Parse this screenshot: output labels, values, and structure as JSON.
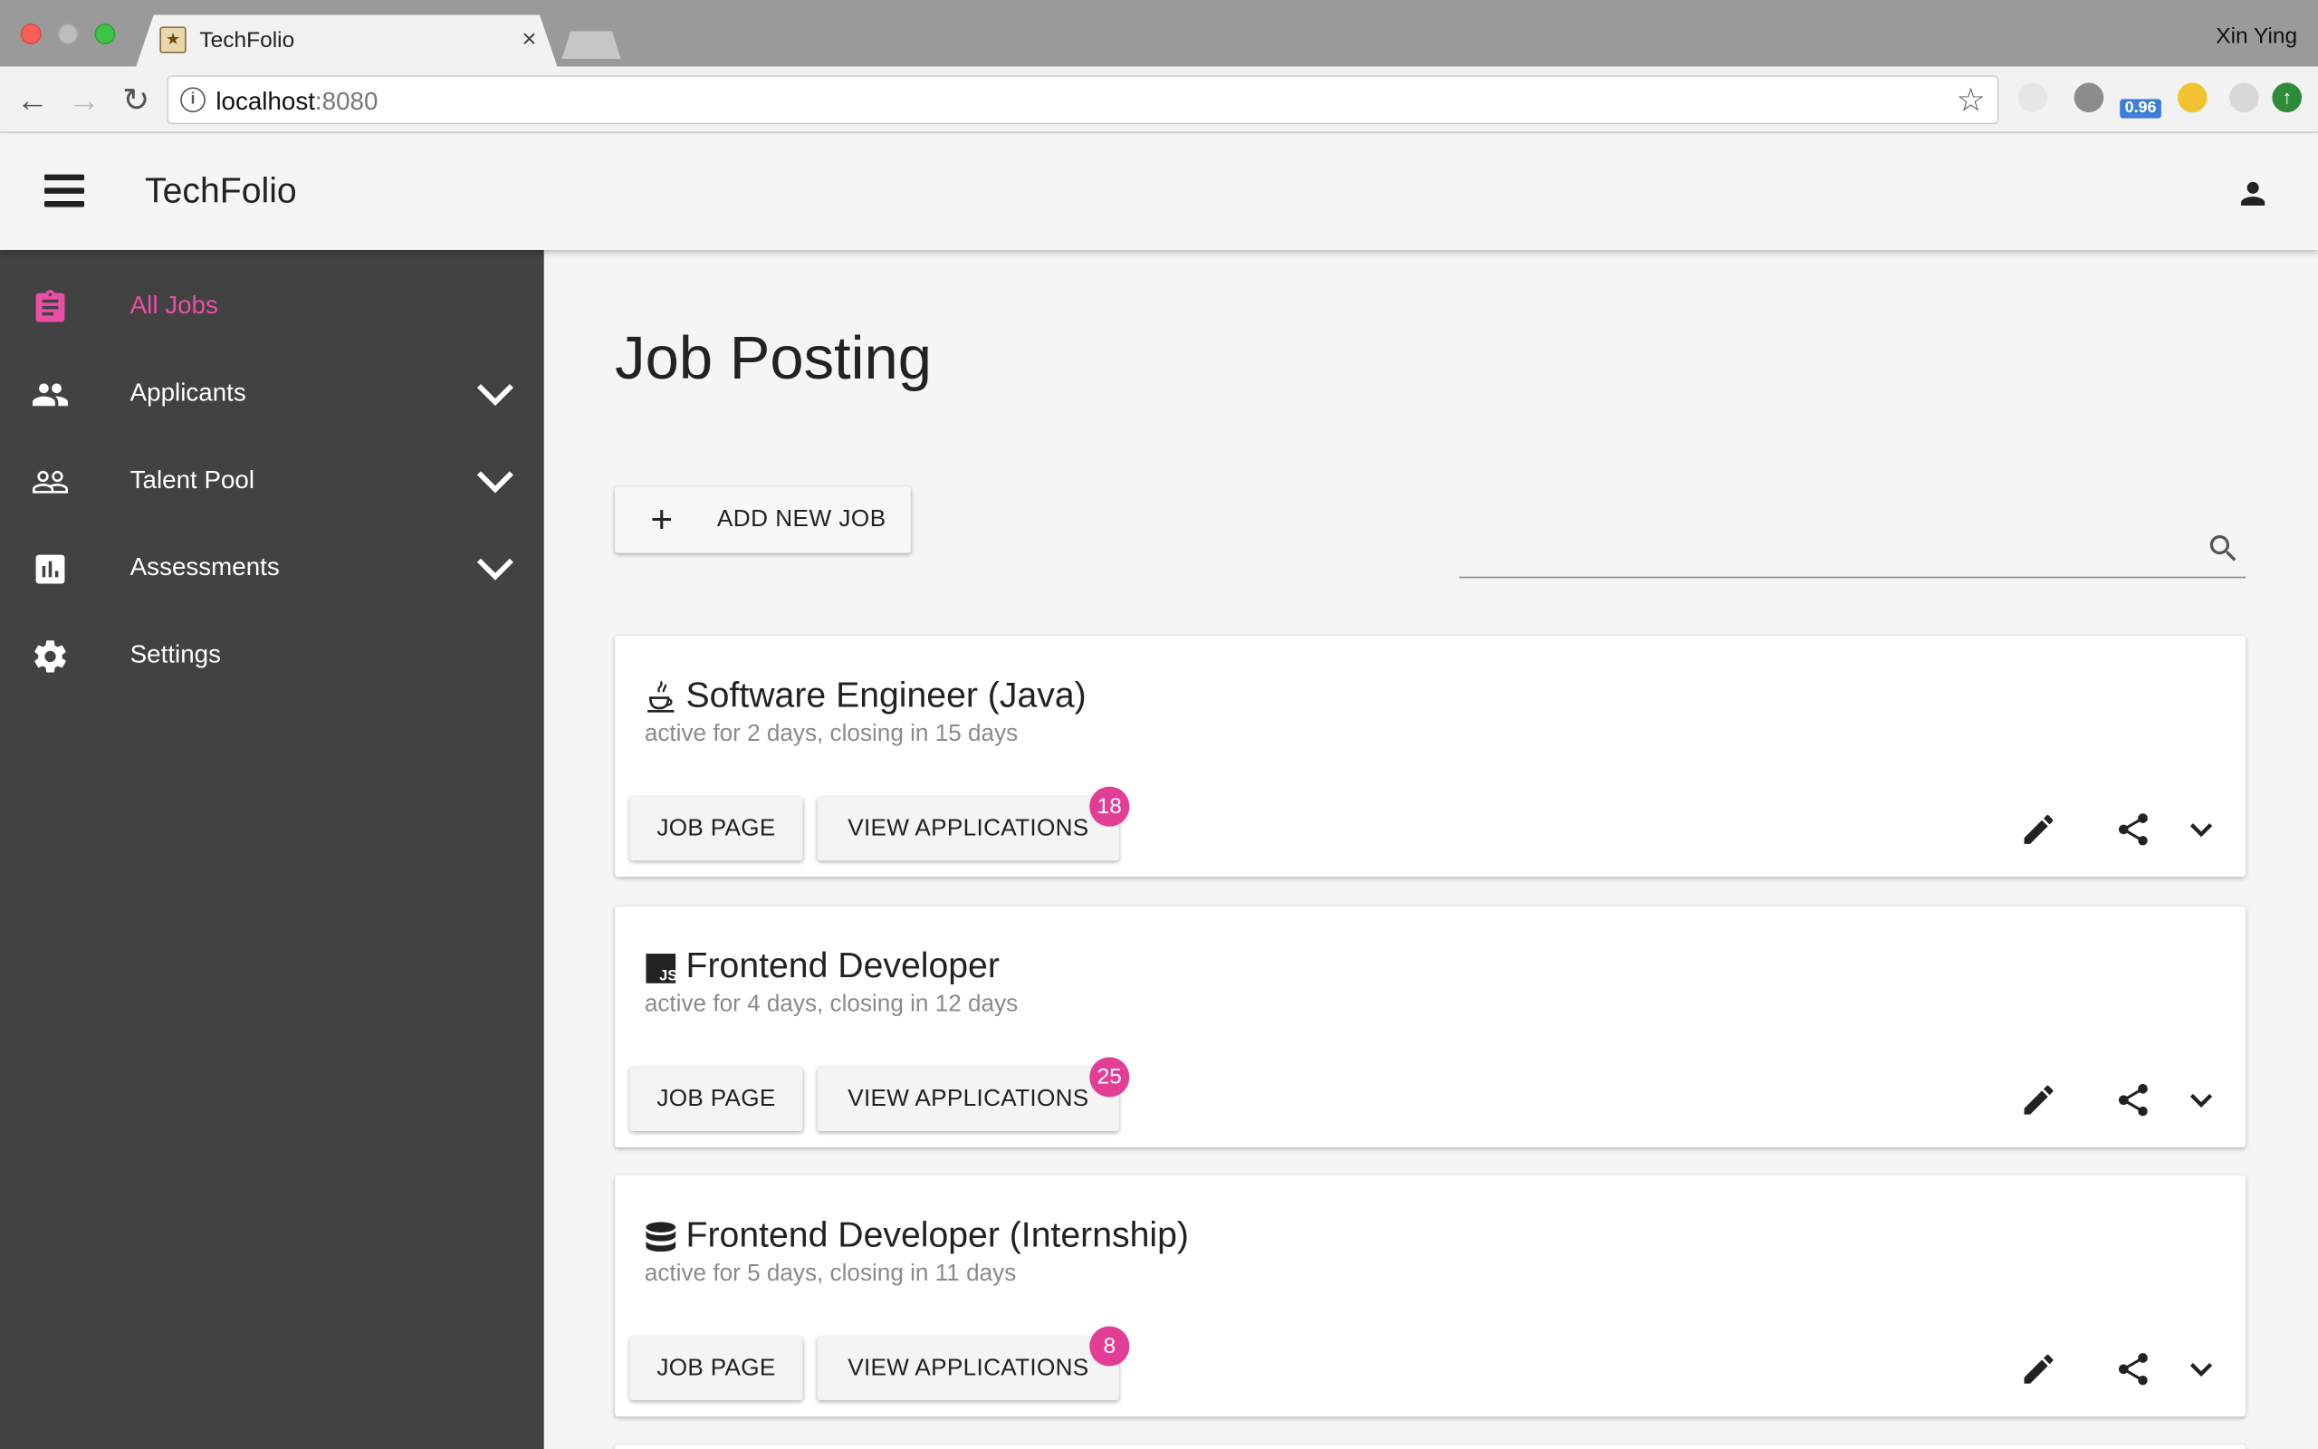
{
  "browser": {
    "tab_title": "TechFolio",
    "profile_name": "Xin Ying",
    "url_host": "localhost",
    "url_port": ":8080",
    "extension_badge": "0.96"
  },
  "appbar": {
    "title": "TechFolio"
  },
  "sidebar": {
    "items": [
      {
        "label": "All Jobs",
        "icon": "clipboard-icon",
        "active": true
      },
      {
        "label": "Applicants",
        "icon": "people-icon",
        "expandable": true
      },
      {
        "label": "Talent Pool",
        "icon": "people-outline-icon",
        "expandable": true
      },
      {
        "label": "Assessments",
        "icon": "bar-chart-icon",
        "expandable": true
      },
      {
        "label": "Settings",
        "icon": "gear-icon"
      }
    ]
  },
  "main": {
    "title": "Job Posting",
    "add_button_label": "ADD NEW JOB",
    "search": {
      "value": "",
      "placeholder": ""
    },
    "jobs": [
      {
        "title": "Software Engineer (Java)",
        "icon": "java-icon",
        "status": "active for 2 days, closing in 15 days",
        "job_page_label": "JOB PAGE",
        "view_apps_label": "VIEW APPLICATIONS",
        "applications": "18"
      },
      {
        "title": "Frontend Developer",
        "icon": "javascript-icon",
        "status": "active for 4 days, closing in 12 days",
        "job_page_label": "JOB PAGE",
        "view_apps_label": "VIEW APPLICATIONS",
        "applications": "25"
      },
      {
        "title": "Frontend Developer (Internship)",
        "icon": "database-icon",
        "status": "active for 5 days, closing in 11 days",
        "job_page_label": "JOB PAGE",
        "view_apps_label": "VIEW APPLICATIONS",
        "applications": "8"
      }
    ]
  },
  "colors": {
    "accent": "#e84fa5",
    "badge": "#e23e95",
    "sidebar_bg": "#424242"
  }
}
